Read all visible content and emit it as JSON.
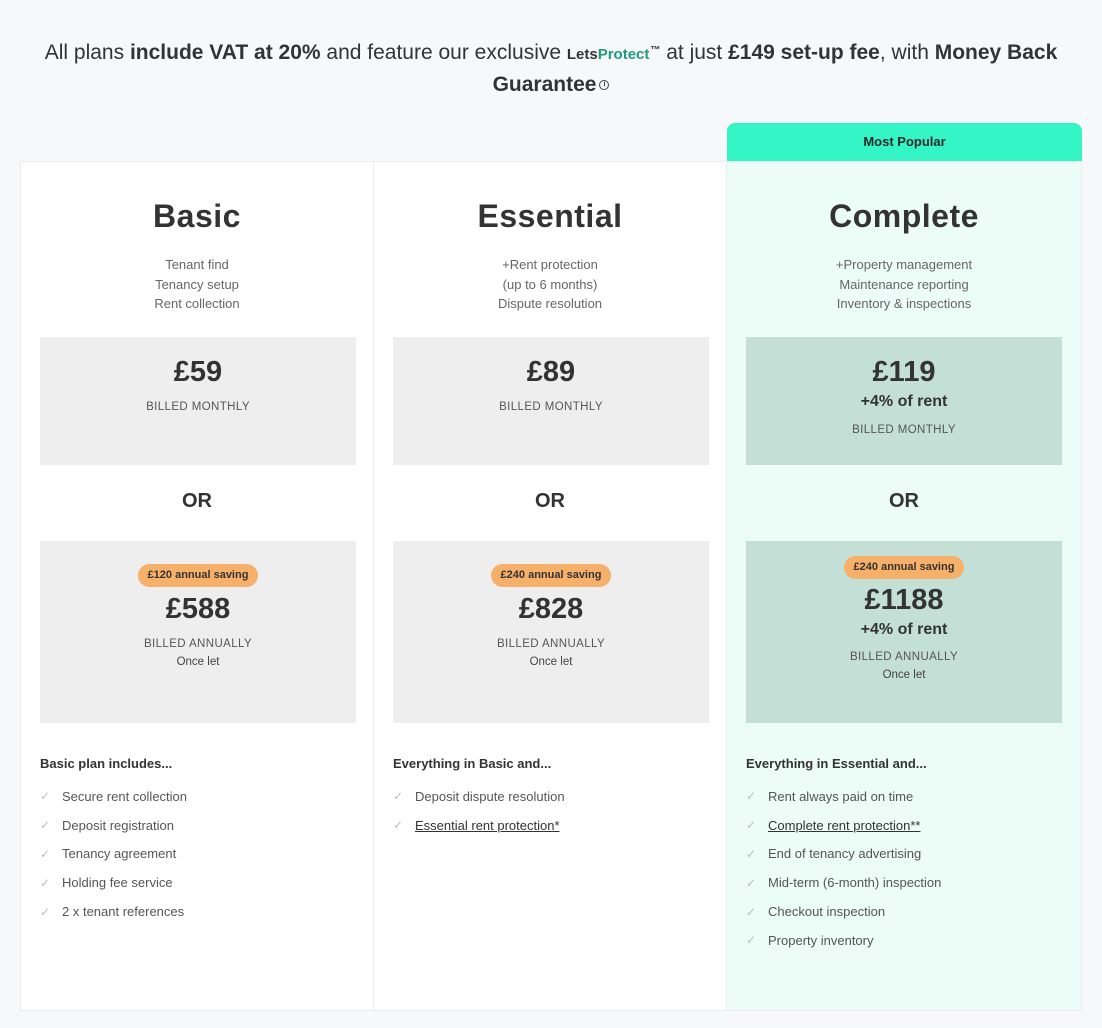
{
  "header": {
    "part1": "All plans ",
    "vat": "include VAT at 20%",
    "part2": " and feature our exclusive ",
    "lets": "Lets",
    "protect": "Protect",
    "tm": "™",
    "part3": " at just ",
    "fee": "£149 set-up fee",
    "part4": ", with ",
    "guarantee": "Money Back Guarantee",
    "info_icon": "info-icon"
  },
  "popular_label": "Most Popular",
  "or_label": "OR",
  "plans": [
    {
      "name": "Basic",
      "summary": [
        "Tenant find",
        "Tenancy setup",
        "Rent collection"
      ],
      "monthly_price": "£59",
      "monthly_extra": "",
      "monthly_billed": "BILLED MONTHLY",
      "saving": "£120 annual saving",
      "annual_price": "£588",
      "annual_extra": "",
      "annual_billed": "BILLED ANNUALLY",
      "annual_note": "Once let",
      "includes_title": "Basic plan includes...",
      "features": [
        "Secure rent collection",
        "Deposit registration",
        "Tenancy agreement",
        "Holding fee service",
        "2 x tenant references"
      ]
    },
    {
      "name": "Essential",
      "summary": [
        "+Rent protection",
        "(up to 6 months)",
        "Dispute resolution"
      ],
      "monthly_price": "£89",
      "monthly_extra": "",
      "monthly_billed": "BILLED MONTHLY",
      "saving": "£240 annual saving",
      "annual_price": "£828",
      "annual_extra": "",
      "annual_billed": "BILLED ANNUALLY",
      "annual_note": "Once let",
      "includes_title": "Everything in Basic and...",
      "features": [
        "Deposit dispute resolution",
        "Essential rent protection*"
      ]
    },
    {
      "name": "Complete",
      "summary": [
        "+Property management",
        "Maintenance reporting",
        "Inventory & inspections"
      ],
      "monthly_price": "£119",
      "monthly_extra": "+4% of rent",
      "monthly_billed": "BILLED MONTHLY",
      "saving": "£240 annual saving",
      "annual_price": "£1188",
      "annual_extra": "+4% of rent",
      "annual_billed": "BILLED ANNUALLY",
      "annual_note": "Once let",
      "includes_title": "Everything in Essential and...",
      "features": [
        "Rent always paid on time",
        "Complete rent protection**",
        "End of tenancy advertising",
        "Mid-term (6-month) inspection",
        "Checkout inspection",
        "Property inventory"
      ]
    }
  ],
  "colors": {
    "accent": "#34f5c6",
    "protect_text": "#1f9b7b",
    "saving_badge": "#f7b06a",
    "complete_bg": "#ecfcf7",
    "complete_price_bg": "#c3dfd6",
    "price_bg": "#eeeeee"
  }
}
